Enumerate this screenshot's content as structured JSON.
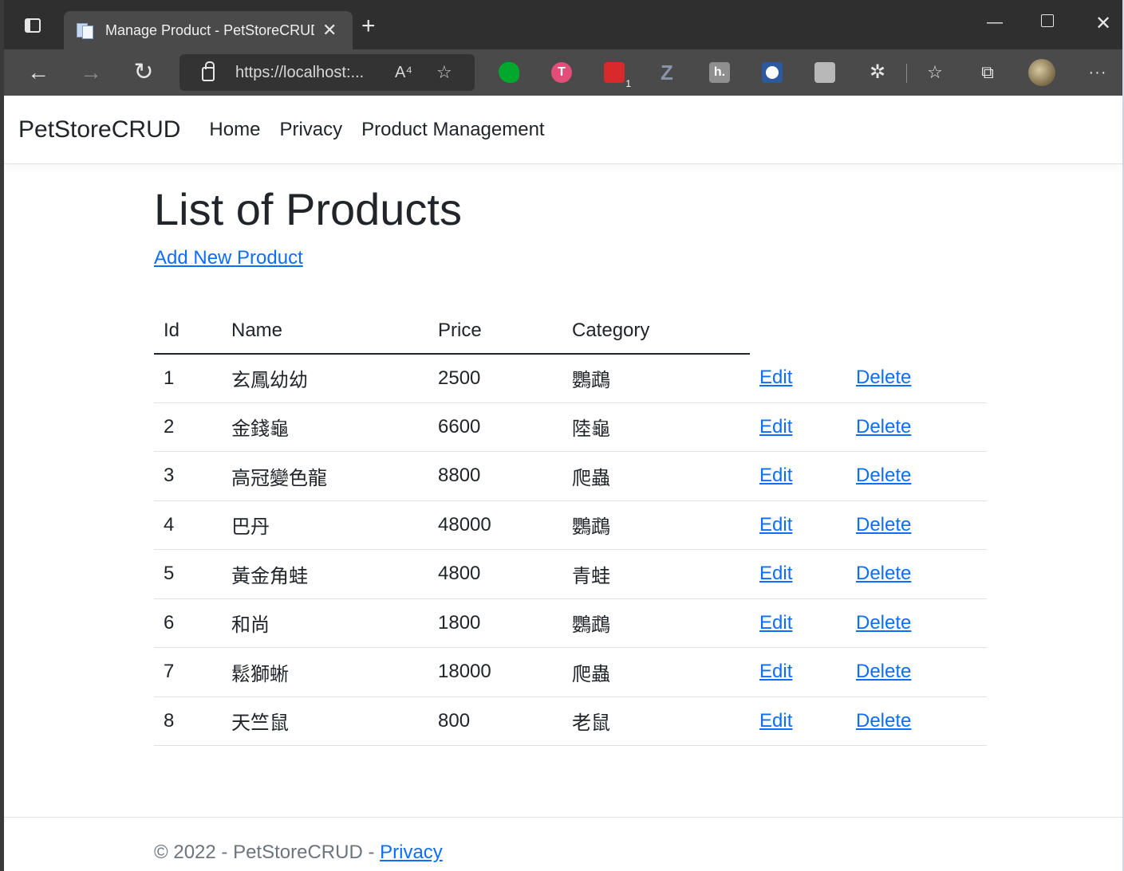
{
  "browser": {
    "tab_title": "Manage Product - PetStoreCRUD",
    "tab_close": "✕",
    "new_tab": "+",
    "url": "https://localhost:...",
    "controls": {
      "minimize": "—",
      "close": "✕"
    },
    "icons": {
      "back": "←",
      "forward": "→",
      "reload": "↻",
      "read_aloud": "A⁴",
      "favorite_add": "☆",
      "favorites": "☆",
      "collections": "⧉",
      "more": "···",
      "extensions": "✲",
      "todoist": "T",
      "meetup_badge": "1",
      "zotero": "Z",
      "hypothesis": "h."
    }
  },
  "site": {
    "brand": "PetStoreCRUD",
    "nav": [
      "Home",
      "Privacy",
      "Product Management"
    ]
  },
  "main": {
    "title": "List of Products",
    "add_link": "Add New Product",
    "columns": [
      "Id",
      "Name",
      "Price",
      "Category"
    ],
    "edit_label": "Edit",
    "delete_label": "Delete",
    "rows": [
      {
        "id": "1",
        "name": "玄鳳幼幼",
        "price": "2500",
        "category": "鸚鵡"
      },
      {
        "id": "2",
        "name": "金錢龜",
        "price": "6600",
        "category": "陸龜"
      },
      {
        "id": "3",
        "name": "高冠變色龍",
        "price": "8800",
        "category": "爬蟲"
      },
      {
        "id": "4",
        "name": "巴丹",
        "price": "48000",
        "category": "鸚鵡"
      },
      {
        "id": "5",
        "name": "黃金角蛙",
        "price": "4800",
        "category": "青蛙"
      },
      {
        "id": "6",
        "name": "和尚",
        "price": "1800",
        "category": "鸚鵡"
      },
      {
        "id": "7",
        "name": "鬆獅蜥",
        "price": "18000",
        "category": "爬蟲"
      },
      {
        "id": "8",
        "name": "天竺鼠",
        "price": "800",
        "category": "老鼠"
      }
    ]
  },
  "footer": {
    "text": "© 2022 - PetStoreCRUD - ",
    "privacy_link": "Privacy"
  },
  "colors": {
    "link": "#0d6efd",
    "text": "#212529",
    "browser_dark": "#2f2f2f",
    "browser_toolbar": "#4a4a4a"
  }
}
